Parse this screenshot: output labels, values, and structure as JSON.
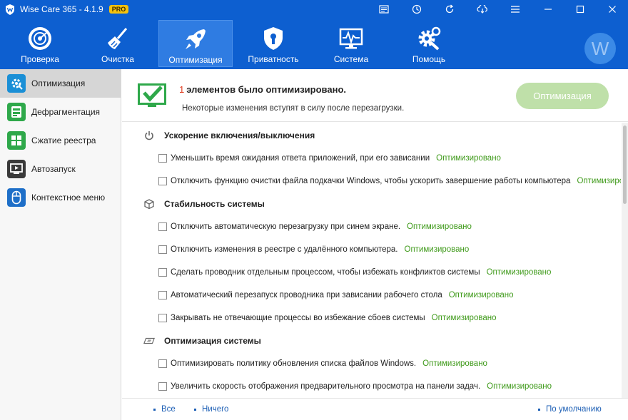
{
  "app": {
    "title": "Wise Care 365 - 4.1.9",
    "badge": "PRO",
    "accent": "#0d5fd0"
  },
  "titlebar_icons": [
    "feedback-icon",
    "history-icon",
    "refresh-icon",
    "cloud-icon",
    "menu-icon",
    "minimize-icon",
    "maximize-icon",
    "close-icon"
  ],
  "nav": {
    "items": [
      {
        "label": "Проверка",
        "icon": "radar-icon"
      },
      {
        "label": "Очистка",
        "icon": "broom-icon"
      },
      {
        "label": "Оптимизация",
        "icon": "rocket-icon",
        "active": true
      },
      {
        "label": "Приватность",
        "icon": "shield-icon"
      },
      {
        "label": "Система",
        "icon": "monitor-icon"
      },
      {
        "label": "Помощь",
        "icon": "gear-tools-icon"
      }
    ],
    "avatar_letter": "W"
  },
  "sidebar": {
    "items": [
      {
        "label": "Оптимизация",
        "icon": "optimize-icon",
        "color": "#1a8fd6",
        "active": true
      },
      {
        "label": "Дефрагментация",
        "icon": "disk-icon",
        "color": "#2ea84a"
      },
      {
        "label": "Сжатие реестра",
        "icon": "registry-icon",
        "color": "#2ea84a"
      },
      {
        "label": "Автозапуск",
        "icon": "startup-icon",
        "color": "#3a3a3a"
      },
      {
        "label": "Контекстное меню",
        "icon": "mouse-icon",
        "color": "#1e6fc8"
      }
    ]
  },
  "header": {
    "count": "1",
    "message": "элементов было оптимизировано.",
    "subtitle": "Некоторые изменения вступят в силу после перезагрузки.",
    "button": "Оптимизация",
    "button_color": "#bfe0a9"
  },
  "sections": [
    {
      "title": "Ускорение включения/выключения",
      "icon": "power-icon",
      "items": [
        {
          "text": "Уменьшить время ожидания ответа приложений, при его зависании",
          "status": "Оптимизировано"
        },
        {
          "text": "Отключить функцию очистки файла подкачки Windows, чтобы ускорить завершение работы компьютера",
          "status": "Оптимизиро..."
        }
      ]
    },
    {
      "title": "Стабильность системы",
      "icon": "cube-icon",
      "items": [
        {
          "text": "Отключить автоматическую перезагрузку при синем экране.",
          "status": "Оптимизировано"
        },
        {
          "text": "Отключить изменения в реестре с удалённого компьютера.",
          "status": "Оптимизировано"
        },
        {
          "text": "Сделать проводник отдельным процессом, чтобы избежать конфликтов системы",
          "status": "Оптимизировано"
        },
        {
          "text": "Автоматический перезапуск проводника при зависании рабочего стола",
          "status": "Оптимизировано"
        },
        {
          "text": "Закрывать не отвечающие процессы во избежание сбоев системы",
          "status": "Оптимизировано"
        }
      ]
    },
    {
      "title": "Оптимизация системы",
      "icon": "speed-icon",
      "items": [
        {
          "text": "Оптимизировать политику обновления списка файлов Windows.",
          "status": "Оптимизировано"
        },
        {
          "text": "Увеличить скорость отображения предварительного просмотра на панели задач.",
          "status": "Оптимизировано"
        }
      ]
    }
  ],
  "footer": {
    "all": "Все",
    "none": "Ничего",
    "default": "По умолчанию"
  }
}
